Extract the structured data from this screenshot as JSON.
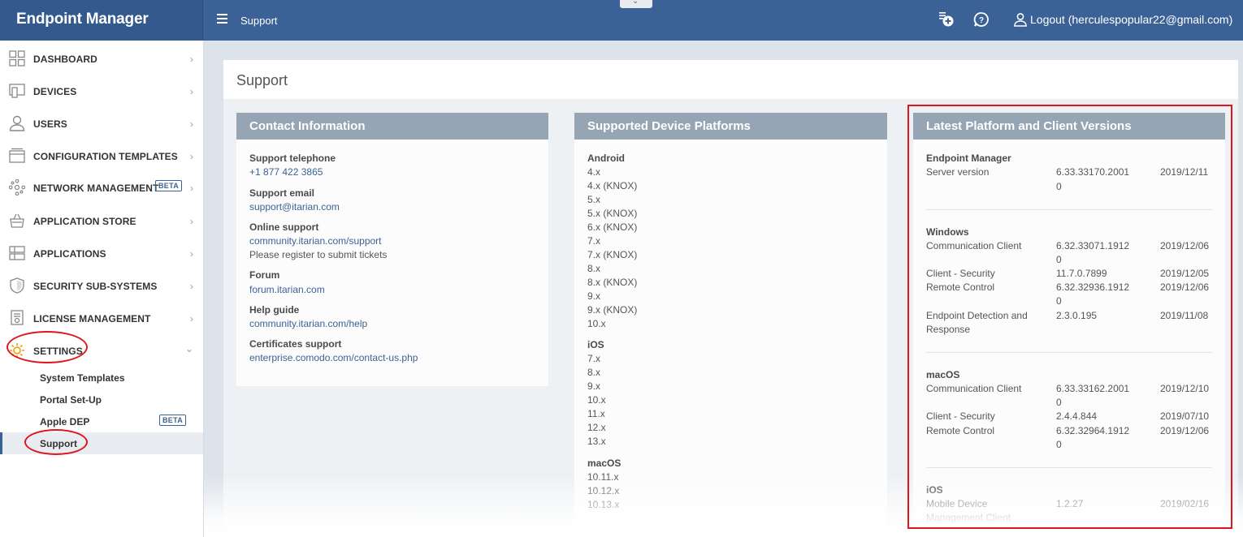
{
  "app": {
    "title": "Endpoint Manager",
    "breadcrumb": "Support"
  },
  "topbar": {
    "logout_label": "Logout (herculespopular22@gmail.com)",
    "pull_tab_glyph": "⌄",
    "icons": [
      "add-ticket-icon",
      "help-icon",
      "user-icon"
    ]
  },
  "sidebar": {
    "items": [
      {
        "label": "DASHBOARD",
        "icon": "dashboard-icon"
      },
      {
        "label": "DEVICES",
        "icon": "devices-icon"
      },
      {
        "label": "USERS",
        "icon": "user-icon"
      },
      {
        "label": "CONFIGURATION TEMPLATES",
        "icon": "templates-icon"
      },
      {
        "label": "NETWORK MANAGEMENT",
        "icon": "network-icon",
        "badge": "BETA"
      },
      {
        "label": "APPLICATION STORE",
        "icon": "store-icon"
      },
      {
        "label": "APPLICATIONS",
        "icon": "applications-icon"
      },
      {
        "label": "SECURITY SUB-SYSTEMS",
        "icon": "shield-icon"
      },
      {
        "label": "LICENSE MANAGEMENT",
        "icon": "license-icon"
      },
      {
        "label": "SETTINGS",
        "icon": "gear-icon",
        "expanded": true
      }
    ],
    "sub_items": [
      {
        "label": "System Templates"
      },
      {
        "label": "Portal Set-Up"
      },
      {
        "label": "Apple DEP",
        "badge": "BETA"
      },
      {
        "label": "Support",
        "active": true
      }
    ]
  },
  "page": {
    "title": "Support"
  },
  "contact": {
    "heading": "Contact Information",
    "entries": [
      {
        "label": "Support telephone",
        "value": "+1 877 422 3865"
      },
      {
        "label": "Support email",
        "value": "support@itarian.com"
      },
      {
        "label": "Online support",
        "value": "community.itarian.com/support",
        "note": "Please register to submit tickets"
      },
      {
        "label": "Forum",
        "value": "forum.itarian.com"
      },
      {
        "label": "Help guide",
        "value": "community.itarian.com/help"
      },
      {
        "label": "Certificates support",
        "value": "enterprise.comodo.com/contact-us.php"
      }
    ]
  },
  "platforms": {
    "heading": "Supported Device Platforms",
    "groups": [
      {
        "name": "Android",
        "versions": [
          "4.x",
          "4.x (KNOX)",
          "5.x",
          "5.x (KNOX)",
          "6.x (KNOX)",
          "7.x",
          "7.x (KNOX)",
          "8.x",
          "8.x (KNOX)",
          "9.x",
          "9.x (KNOX)",
          "10.x"
        ]
      },
      {
        "name": "iOS",
        "versions": [
          "7.x",
          "8.x",
          "9.x",
          "10.x",
          "11.x",
          "12.x",
          "13.x"
        ]
      },
      {
        "name": "macOS",
        "versions": [
          "10.11.x",
          "10.12.x",
          "10.13.x"
        ]
      }
    ]
  },
  "versions": {
    "heading": "Latest Platform and Client Versions",
    "groups": [
      {
        "name": "Endpoint Manager",
        "rows": [
          {
            "name": "Server version",
            "version": "6.33.33170.2001",
            "version_wrap": "0",
            "date": "2019/12/11"
          }
        ]
      },
      {
        "name": "Windows",
        "rows": [
          {
            "name": "Communication Client",
            "version": "6.32.33071.1912",
            "version_wrap": "0",
            "date": "2019/12/06"
          },
          {
            "name": "Client - Security",
            "version": "11.7.0.7899",
            "date": "2019/12/05"
          },
          {
            "name": "Remote Control",
            "version": "6.32.32936.1912",
            "version_wrap": "0",
            "date": "2019/12/06"
          },
          {
            "name": "Endpoint Detection and",
            "name_wrap": "Response",
            "version": "2.3.0.195",
            "date": "2019/11/08"
          }
        ]
      },
      {
        "name": "macOS",
        "rows": [
          {
            "name": "Communication Client",
            "version": "6.33.33162.2001",
            "version_wrap": "0",
            "date": "2019/12/10"
          },
          {
            "name": "Client - Security",
            "version": "2.4.4.844",
            "date": "2019/07/10"
          },
          {
            "name": "Remote Control",
            "version": "6.32.32964.1912",
            "version_wrap": "0",
            "date": "2019/12/06"
          }
        ]
      },
      {
        "name": "iOS",
        "rows": [
          {
            "name": "Mobile Device",
            "name_wrap": "Management Client",
            "version": "1.2.27",
            "date": "2019/02/16"
          }
        ]
      }
    ]
  },
  "colors": {
    "topbar": "#3b6296",
    "card_head": "#95a5b3",
    "link": "#3b6296",
    "highlight": "#e0141e"
  }
}
